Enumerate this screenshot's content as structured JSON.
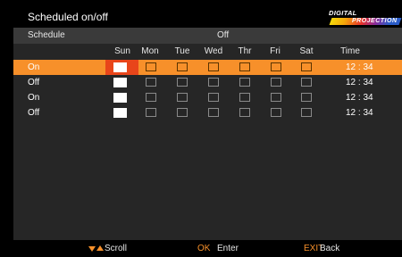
{
  "header": {
    "title": "Scheduled on/off",
    "logo_top": "DIGITAL",
    "logo_bottom": "PROJECTION"
  },
  "schedule": {
    "label": "Schedule",
    "value": "Off"
  },
  "columns": [
    "Sun",
    "Mon",
    "Tue",
    "Wed",
    "Thr",
    "Fri",
    "Sat",
    "Time"
  ],
  "rows": [
    {
      "label": "On",
      "time": "12 : 34",
      "days": [
        true,
        false,
        false,
        false,
        false,
        false,
        false
      ]
    },
    {
      "label": "Off",
      "time": "12 : 34",
      "days": [
        true,
        false,
        false,
        false,
        false,
        false,
        false
      ]
    },
    {
      "label": "On",
      "time": "12 : 34",
      "days": [
        true,
        false,
        false,
        false,
        false,
        false,
        false
      ]
    },
    {
      "label": "Off",
      "time": "12 : 34",
      "days": [
        true,
        false,
        false,
        false,
        false,
        false,
        false
      ]
    }
  ],
  "footer": {
    "scroll_label": "Scroll",
    "ok_key": "OK",
    "ok_label": "Enter",
    "exit_key": "EXIT",
    "exit_label": "Back"
  },
  "colors": {
    "accent": "#f7902a",
    "focus": "#e8451a",
    "panel": "#262626",
    "header_row": "#3a3a3a"
  }
}
